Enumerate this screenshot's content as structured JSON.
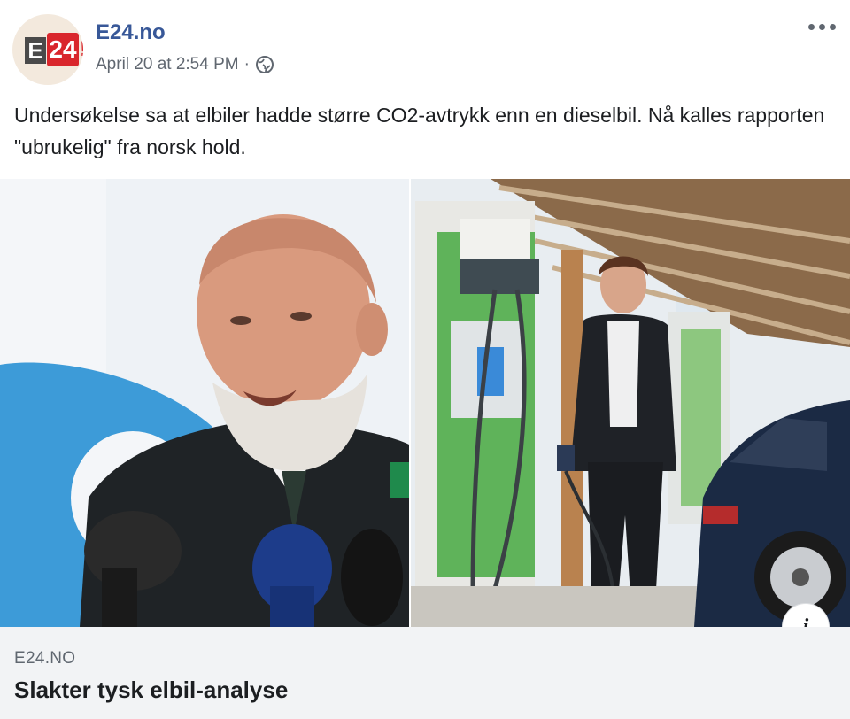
{
  "page": {
    "name": "E24.no",
    "logo_text_e": "E",
    "logo_text_24": "24",
    "logo_text_bang": "!",
    "timestamp": "April 20 at 2:54 PM",
    "separator": "·",
    "audience_icon": "globe-icon",
    "more_icon": "ellipsis-icon"
  },
  "post": {
    "text": "Undersøkelse sa at elbiler hadde større CO2-avtrykk enn en dieselbil. Nå kalles rapporten \"ubrukelig\" fra norsk hold."
  },
  "link_preview": {
    "domain": "E24.NO",
    "title": "Slakter tysk elbil-analyse",
    "info_label": "i"
  },
  "colors": {
    "link_blue": "#385898",
    "meta_gray": "#606770",
    "text_dark": "#1c1e21",
    "footer_bg": "#f2f3f5",
    "logo_red": "#d9262c",
    "logo_dark": "#4a4a4a"
  }
}
